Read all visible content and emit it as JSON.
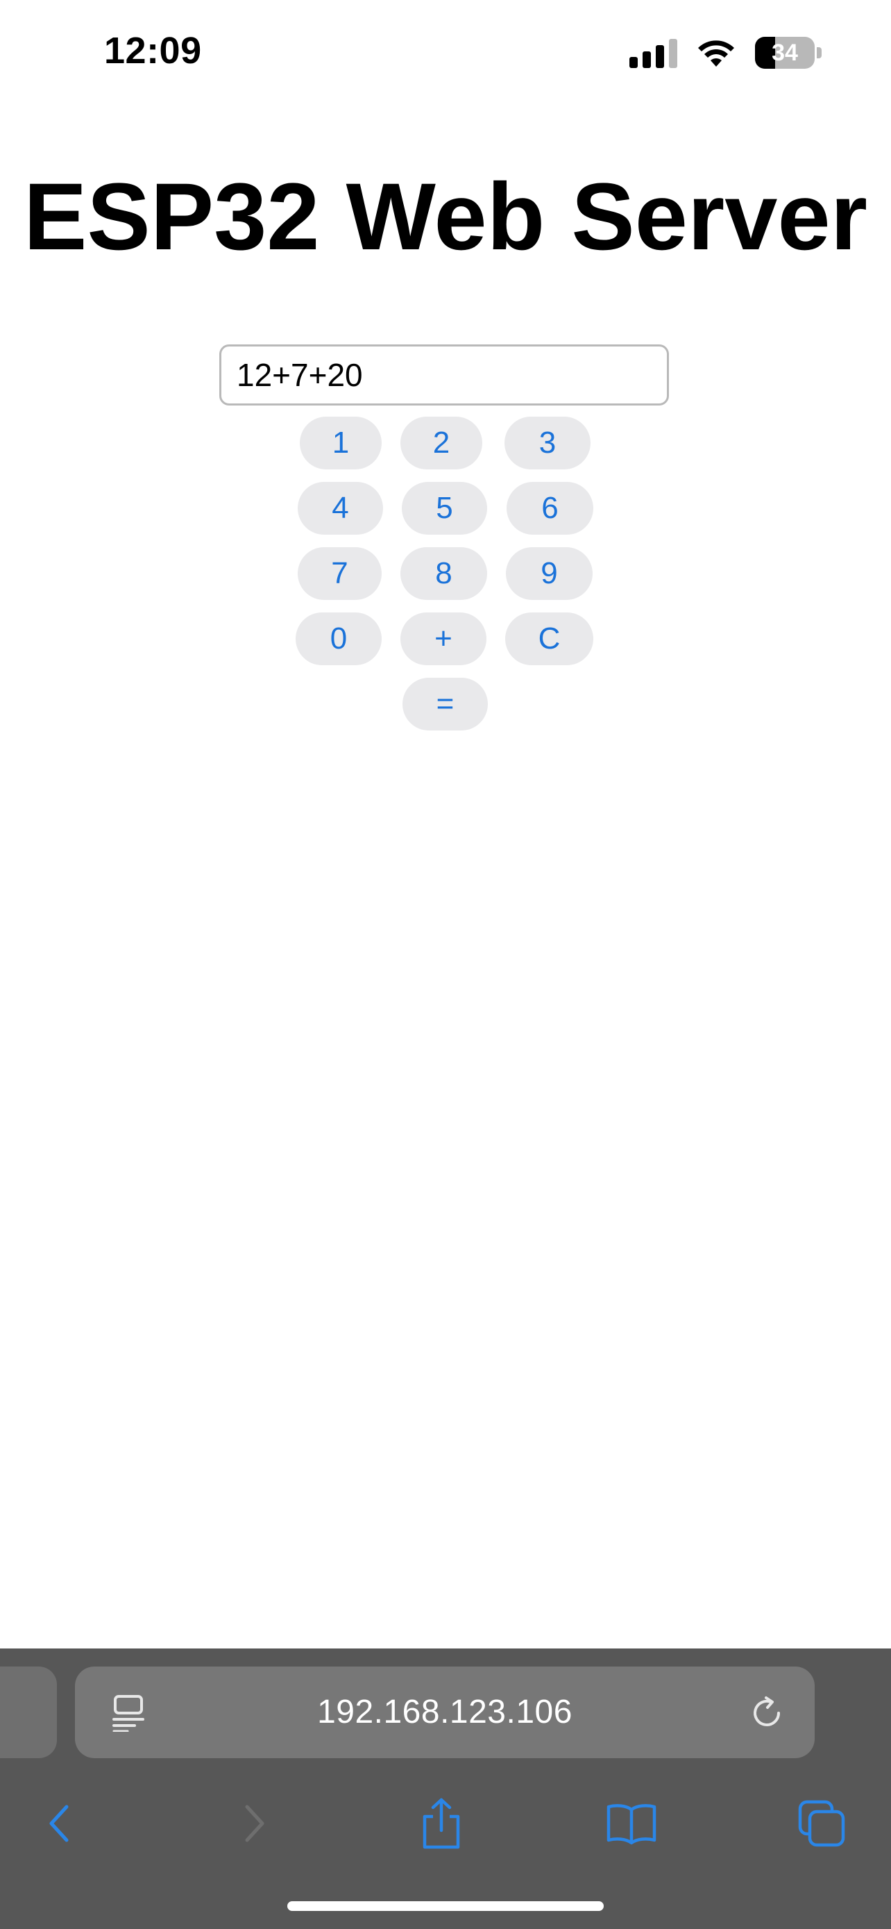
{
  "status_bar": {
    "time": "12:09",
    "battery_percent": 34,
    "battery_label": "34",
    "signal_bars_active": 3,
    "signal_bars_total": 4
  },
  "page": {
    "title": "ESP32 Web Server",
    "display_value": "12+7+20"
  },
  "keypad": {
    "key_1": "1",
    "key_2": "2",
    "key_3": "3",
    "key_4": "4",
    "key_5": "5",
    "key_6": "6",
    "key_7": "7",
    "key_8": "8",
    "key_9": "9",
    "key_0": "0",
    "key_plus": "+",
    "key_clear": "C",
    "key_equals": "="
  },
  "browser": {
    "url": "192.168.123.106",
    "toolbar_icons": [
      "back-icon",
      "forward-icon",
      "share-icon",
      "bookmarks-icon",
      "tabs-icon"
    ]
  },
  "colors": {
    "button_text": "#1a72d9",
    "button_bg": "#e9e9eb",
    "safari_chrome": "#575757",
    "toolbar_accent": "#2a86e8"
  }
}
